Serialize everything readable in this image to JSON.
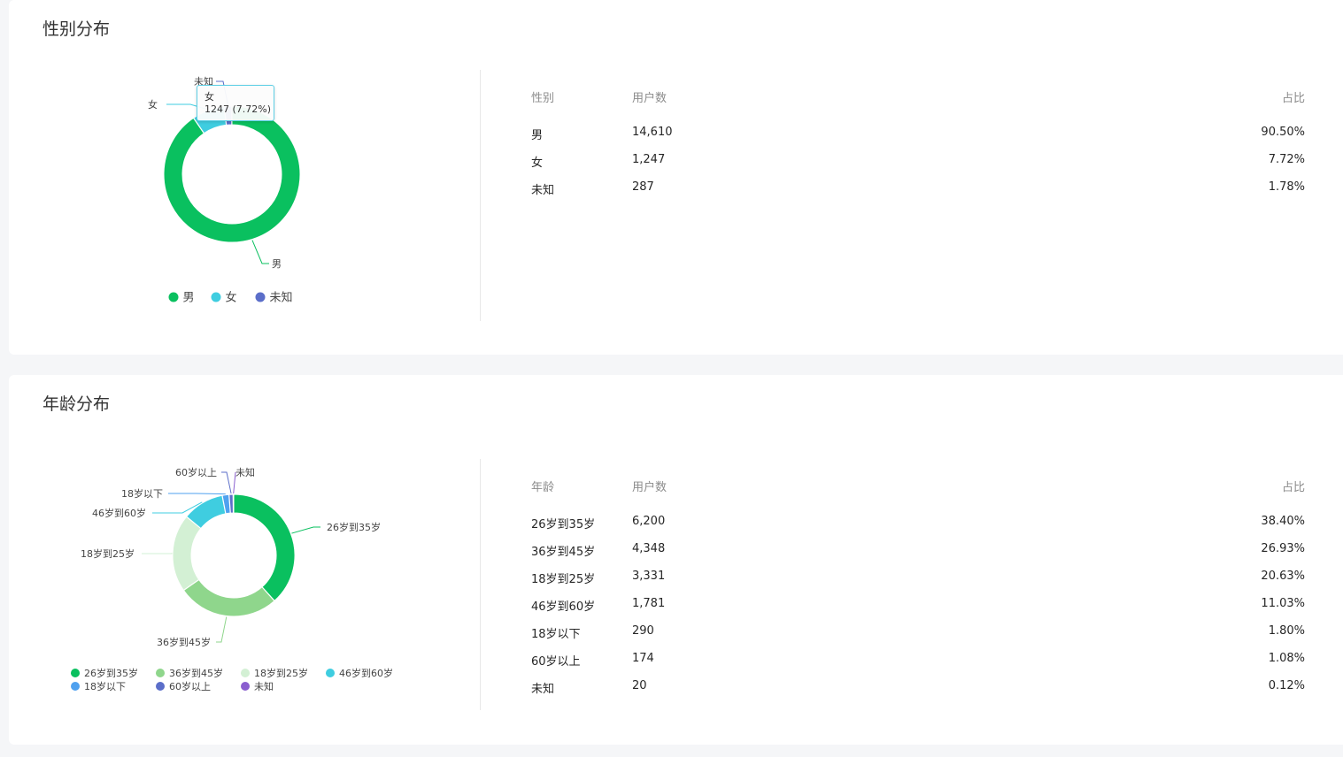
{
  "gender_section": {
    "title": "性别分布",
    "table": {
      "headers": [
        "性别",
        "用户数",
        "占比"
      ],
      "rows": [
        [
          "男",
          "14,610",
          "90.50%"
        ],
        [
          "女",
          "1,247",
          "7.72%"
        ],
        [
          "未知",
          "287",
          "1.78%"
        ]
      ]
    },
    "tooltip": {
      "label": "女",
      "value": "1247 (7.72%)"
    }
  },
  "age_section": {
    "title": "年龄分布",
    "table": {
      "headers": [
        "年龄",
        "用户数",
        "占比"
      ],
      "rows": [
        [
          "26岁到35岁",
          "6,200",
          "38.40%"
        ],
        [
          "36岁到45岁",
          "4,348",
          "26.93%"
        ],
        [
          "18岁到25岁",
          "3,331",
          "20.63%"
        ],
        [
          "46岁到60岁",
          "1,781",
          "11.03%"
        ],
        [
          "18岁以下",
          "290",
          "1.80%"
        ],
        [
          "60岁以上",
          "174",
          "1.08%"
        ],
        [
          "未知",
          "20",
          "0.12%"
        ]
      ]
    }
  },
  "chart_data": [
    {
      "type": "pie",
      "donut": true,
      "legend_position": "bottom",
      "categories": [
        "男",
        "女",
        "未知"
      ],
      "values": [
        14610,
        1247,
        287
      ],
      "colors": [
        "#0ac05f",
        "#3fcde0",
        "#5b6ec9"
      ],
      "legend": [
        "男",
        "女",
        "未知"
      ]
    },
    {
      "type": "pie",
      "donut": true,
      "legend_position": "bottom",
      "categories": [
        "26岁到35岁",
        "36岁到45岁",
        "18岁到25岁",
        "46岁到60岁",
        "18岁以下",
        "60岁以上",
        "未知"
      ],
      "values": [
        6200,
        4348,
        3331,
        1781,
        290,
        174,
        20
      ],
      "colors": [
        "#0ac05f",
        "#8fd68c",
        "#d3f0d4",
        "#3fcde0",
        "#4fa1ef",
        "#5b6ec9",
        "#8a5fcf"
      ],
      "legend": [
        "26岁到35岁",
        "36岁到45岁",
        "18岁到25岁",
        "46岁到60岁",
        "18岁以下",
        "60岁以上",
        "未知"
      ]
    }
  ]
}
